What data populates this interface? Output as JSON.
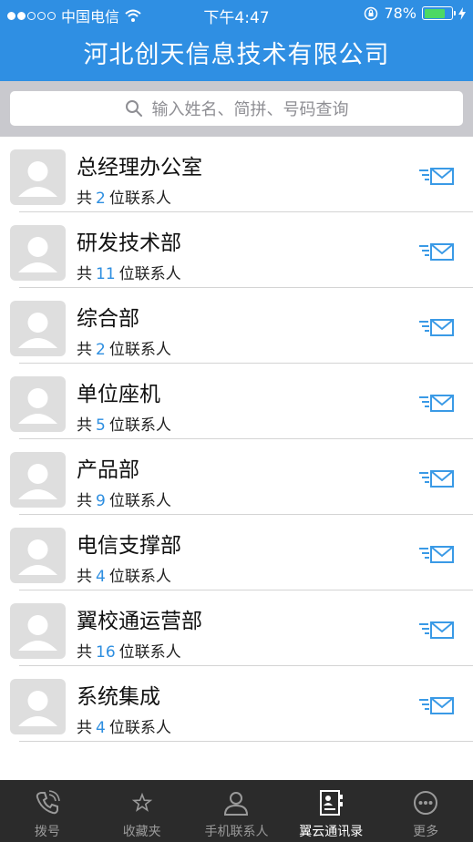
{
  "status_bar": {
    "signal_dots_filled": 2,
    "signal_dots_total": 5,
    "carrier": "中国电信",
    "time": "下午4:47",
    "battery_percent": "78%",
    "battery_level": 0.78
  },
  "header": {
    "title": "河北创天信息技术有限公司"
  },
  "search": {
    "placeholder": "输入姓名、简拼、号码查询"
  },
  "count_prefix": "共",
  "count_suffix": "位联系人",
  "departments": [
    {
      "name": "总经理办公室",
      "count": "2"
    },
    {
      "name": "研发技术部",
      "count": "11"
    },
    {
      "name": "综合部",
      "count": "2"
    },
    {
      "name": "单位座机",
      "count": "5"
    },
    {
      "name": "产品部",
      "count": "9"
    },
    {
      "name": "电信支撑部",
      "count": "4"
    },
    {
      "name": "翼校通运营部",
      "count": "16"
    },
    {
      "name": "系统集成",
      "count": "4"
    }
  ],
  "tabs": [
    {
      "label": "拨号",
      "icon": "phone-icon",
      "active": false
    },
    {
      "label": "收藏夹",
      "icon": "star-icon",
      "active": false
    },
    {
      "label": "手机联系人",
      "icon": "person-icon",
      "active": false
    },
    {
      "label": "翼云通讯录",
      "icon": "contacts-book-icon",
      "active": true
    },
    {
      "label": "更多",
      "icon": "more-icon",
      "active": false
    }
  ],
  "colors": {
    "header_blue": "#2f8fe3",
    "count_blue": "#2d8ee0",
    "tabbar_bg": "#2b2b2b",
    "battery_green": "#4cd964"
  }
}
